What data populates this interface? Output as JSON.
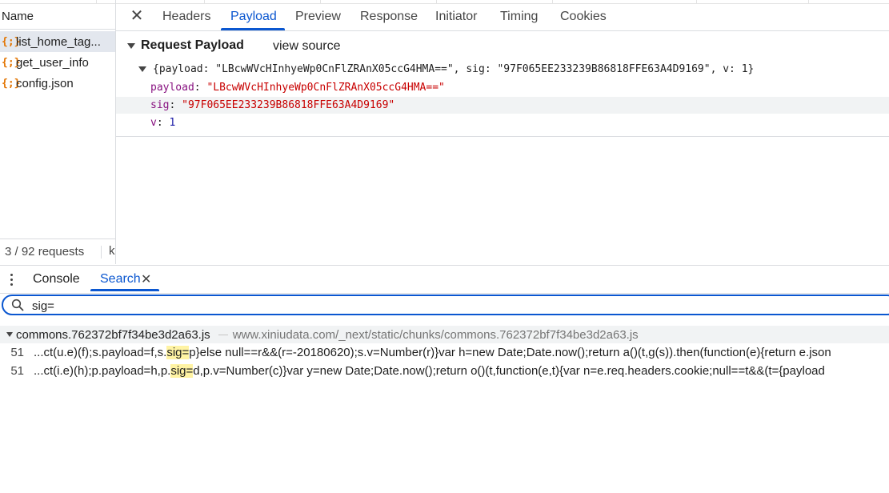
{
  "network": {
    "name_header": "Name",
    "requests": [
      {
        "icon": "{;}",
        "name": "list_home_tag..."
      },
      {
        "icon": "{;}",
        "name": "get_user_info"
      },
      {
        "icon": "{;}",
        "name": "config.json"
      }
    ],
    "footer_count": "3 / 92 requests",
    "footer_tail": "k"
  },
  "detail": {
    "close_glyph": "✕",
    "tabs": [
      "Headers",
      "Payload",
      "Preview",
      "Response",
      "Initiator",
      "Timing",
      "Cookies"
    ],
    "active_tab": "Payload",
    "section_title": "Request Payload",
    "view_source": "view source",
    "summary": "{payload: \"LBcwWVcHInhyeWp0CnFlZRAnX05ccG4HMA==\", sig: \"97F065EE233239B86818FFE63A4D9169\", v: 1}",
    "props": [
      {
        "key": "payload",
        "value": "\"LBcwWVcHInhyeWp0CnFlZRAnX05ccG4HMA==\""
      },
      {
        "key": "sig",
        "value": "\"97F065EE233239B86818FFE63A4D9169\""
      },
      {
        "key": "v",
        "value": "1"
      }
    ]
  },
  "drawer": {
    "tabs": [
      "Console",
      "Search"
    ],
    "active_tab": "Search",
    "close_glyph": "✕",
    "search_value": "sig=",
    "result": {
      "file": "commons.762372bf7f34be3d2a63.js",
      "url": "www.xiniudata.com/_next/static/chunks/commons.762372bf7f34be3d2a63.js",
      "matches": [
        {
          "line": "51",
          "before": "...ct(u.e)(f);s.payload=f,s.",
          "match": "sig=",
          "after": "p}else null==r&&(r=-20180620);s.v=Number(r)}var h=new Date;Date.now();return a()(t,g(s)).then(function(e){return e.json"
        },
        {
          "line": "51",
          "before": "...ct(i.e)(h);p.payload=h,p.",
          "match": "sig=",
          "after": "d,p.v=Number(c)}var y=new Date;Date.now();return o()(t,function(e,t){var n=e.req.headers.cookie;null==t&&(t={payload"
        }
      ]
    }
  },
  "colors": {
    "accent": "#0b57d0",
    "string": "#c80000",
    "key": "#881280",
    "number": "#1a1aa6",
    "match_highlight": "#fff3a3"
  }
}
